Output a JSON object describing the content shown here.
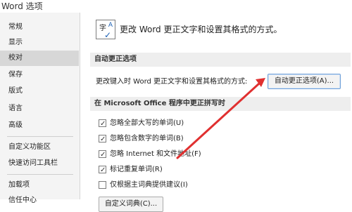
{
  "window": {
    "title": "Word 选项"
  },
  "sidebar": {
    "items": [
      {
        "label": "常规"
      },
      {
        "label": "显示"
      },
      {
        "label": "校对",
        "selected": true
      },
      {
        "label": "保存"
      },
      {
        "label": "版式"
      },
      {
        "label": "语言"
      },
      {
        "label": "高级"
      },
      {
        "label": "自定义功能区"
      },
      {
        "label": "快速访问工具栏"
      },
      {
        "label": "加载项"
      },
      {
        "label": "信任中心"
      }
    ]
  },
  "main": {
    "header": {
      "icon": "autocorrect-icon",
      "icon_glyph": "字",
      "icon_a": "A",
      "text": "更改 Word 更正文字和设置其格式的方式。"
    },
    "autocorrect_section": {
      "title": "自动更正选项",
      "description": "更改键入时 Word 更正文字和设置其格式的方式:",
      "button_label": "自动更正选项(A)..."
    },
    "spelling_section": {
      "title": "在 Microsoft Office 程序中更正拼写时",
      "options": [
        {
          "label": "忽略全部大写的单词(U)",
          "checked": true
        },
        {
          "label": "忽略包含数字的单词(B)",
          "checked": true
        },
        {
          "label": "忽略 Internet 和文件地址(F)",
          "checked": true
        },
        {
          "label": "标记重复单词(R)",
          "checked": true
        },
        {
          "label": "仅根据主词典提供建议(I)",
          "checked": false
        }
      ],
      "custom_dict_button": "自定义词典(C)..."
    }
  },
  "annotation": {
    "color": "#e03030"
  }
}
